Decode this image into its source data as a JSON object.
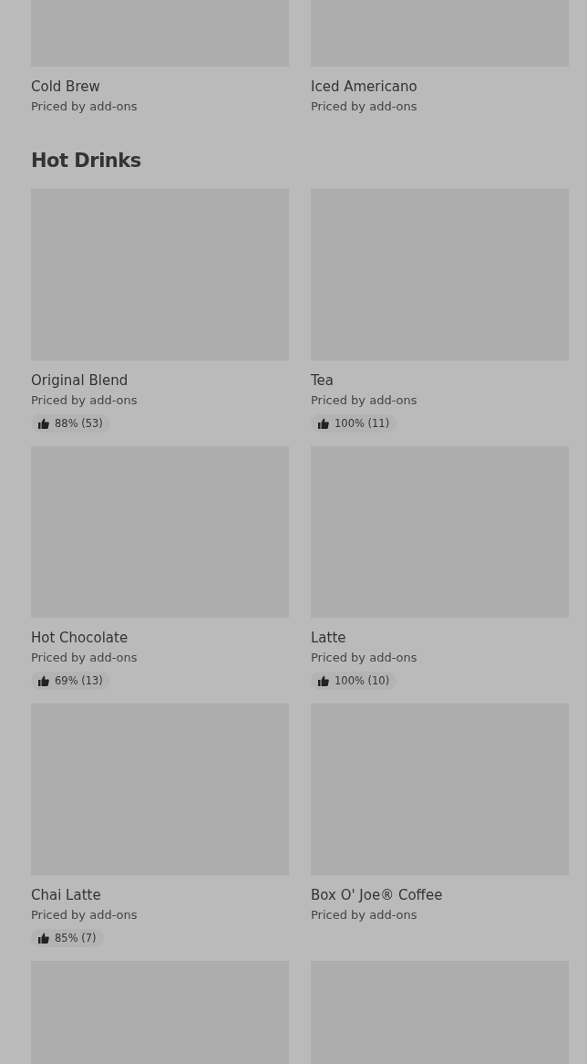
{
  "sections": [
    {
      "items": [
        {
          "kind": "item",
          "name": "Cold Brew",
          "subtitle": "Priced by add-ons"
        },
        {
          "kind": "item",
          "name": "Iced Americano",
          "subtitle": "Priced by add-ons"
        }
      ]
    },
    {
      "title": "Hot Drinks",
      "items": [
        {
          "kind": "item",
          "name": "Original Blend",
          "subtitle": "Priced by add-ons",
          "rating": "88% (53)"
        },
        {
          "kind": "item",
          "name": "Tea",
          "subtitle": "Priced by add-ons",
          "rating": "100% (11)"
        },
        {
          "kind": "item",
          "name": "Hot Chocolate",
          "subtitle": "Priced by add-ons",
          "rating": "69% (13)"
        },
        {
          "kind": "item",
          "name": "Latte",
          "subtitle": "Priced by add-ons",
          "rating": "100% (10)"
        },
        {
          "kind": "item",
          "name": "Chai Latte",
          "subtitle": "Priced by add-ons",
          "rating": "85% (7)"
        },
        {
          "kind": "item",
          "name": "Box O' Joe® Coffee",
          "subtitle": "Priced by add-ons"
        },
        {
          "kind": "picture"
        },
        {
          "kind": "picture"
        }
      ]
    }
  ]
}
